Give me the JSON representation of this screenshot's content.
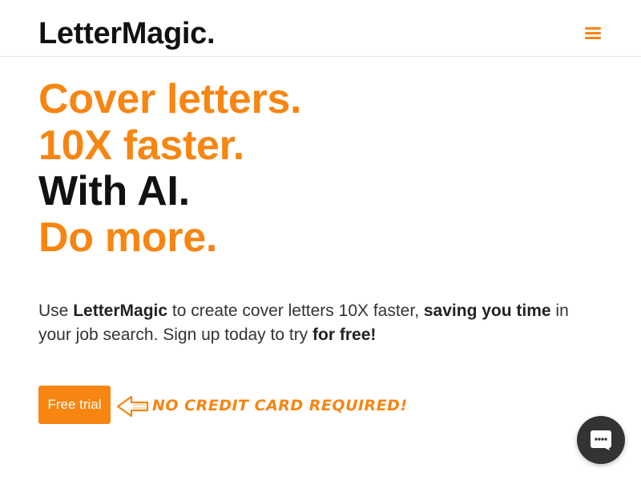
{
  "header": {
    "logo": "LetterMagic.",
    "menu_icon": "hamburger-menu-icon"
  },
  "hero": {
    "lines": [
      "Cover letters.",
      "10X faster.",
      "With AI.",
      "Do more."
    ],
    "intro": {
      "part1": "Use ",
      "brand": "LetterMagic",
      "part2": " to create cover letters 10X faster, ",
      "bold1": "saving you time",
      "part3": " in your job search. Sign up today to try ",
      "bold2": "for free!"
    }
  },
  "cta": {
    "button_label": "Free trial",
    "note": "NO CREDIT CARD REQUIRED!",
    "arrow_icon": "left-arrow-icon"
  },
  "chat": {
    "icon": "chat-bubble-icon"
  },
  "colors": {
    "accent": "#f68512",
    "text_dark": "#111111",
    "chat_bg": "#333333"
  }
}
